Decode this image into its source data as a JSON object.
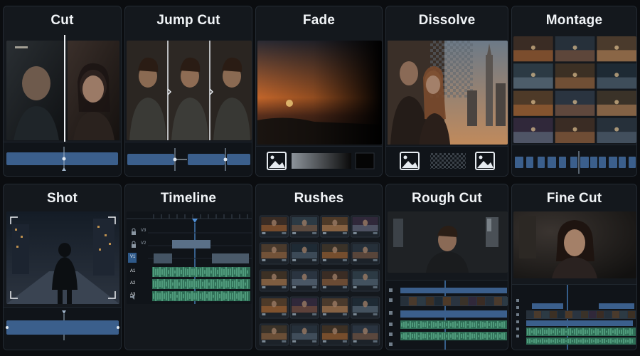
{
  "panels": [
    {
      "title": "Cut"
    },
    {
      "title": "Jump Cut"
    },
    {
      "title": "Fade"
    },
    {
      "title": "Dissolve"
    },
    {
      "title": "Montage"
    },
    {
      "title": "Shot"
    },
    {
      "title": "Timeline"
    },
    {
      "title": "Rushes"
    },
    {
      "title": "Rough Cut"
    },
    {
      "title": "Fine Cut"
    }
  ],
  "timeline": {
    "tracks": [
      "V3",
      "V2",
      "V1",
      "A1",
      "A2",
      "A3"
    ]
  },
  "icons": [
    "image-icon",
    "lock-icon",
    "eye-icon",
    "speaker-icon",
    "playhead-icon"
  ],
  "colors": {
    "background": "#0b0d10",
    "panel": "#14181d",
    "clip_blue": "#3b5f8c",
    "audio_green": "#3f8a6c",
    "playhead": "#4f8fd6"
  }
}
